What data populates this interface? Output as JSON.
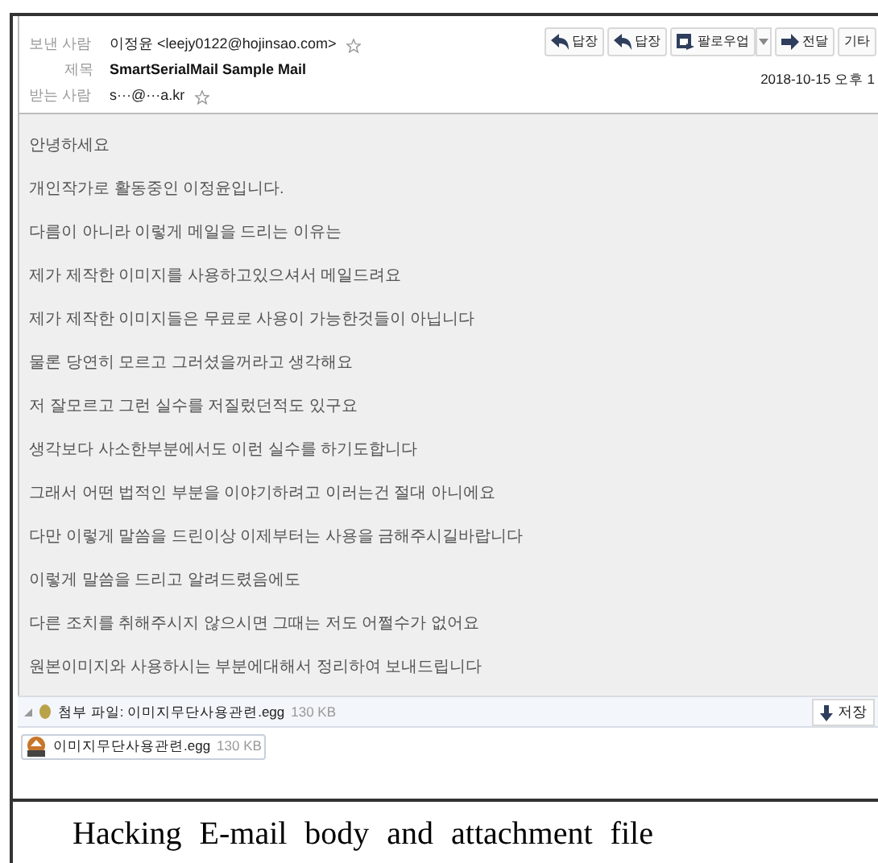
{
  "header": {
    "from_label": "보낸 사람",
    "from": "이정윤 <leejy0122@hojinsao.com>",
    "subject_label": "제목",
    "subject": "SmartSerialMail Sample Mail",
    "to_label": "받는 사람",
    "to": "s···@···a.kr",
    "date": "2018-10-15 오후 1"
  },
  "buttons": [
    {
      "label": "답장",
      "kind": "reply"
    },
    {
      "label": "답장",
      "kind": "reply-all"
    },
    {
      "label": "팔로우업",
      "kind": "followup"
    },
    {
      "label": "전달",
      "kind": "forward"
    },
    {
      "label": "기타",
      "kind": "more"
    }
  ],
  "body": [
    "안녕하세요",
    "개인작가로 활동중인 이정윤입니다.",
    "다름이 아니라 이렇게 메일을 드리는 이유는",
    "제가 제작한 이미지를 사용하고있으셔서 메일드려요",
    "제가 제작한 이미지들은 무료로 사용이 가능한것들이 아닙니다",
    "물론 당연히 모르고 그러셨을꺼라고 생각해요",
    "저 잘모르고 그런 실수를 저질렀던적도 있구요",
    "생각보다 사소한부분에서도 이런 실수를 하기도합니다",
    "그래서 어떤 법적인 부분을 이야기하려고 이러는건 절대 아니에요",
    "다만 이렇게 말씀을 드린이상 이제부터는 사용을 금해주시길바랍니다",
    "이렇게 말씀을 드리고 알려드렸음에도",
    "다른 조치를 취해주시지 않으시면 그때는 저도 어쩔수가 없어요",
    "원본이미지와 사용하시는 부분에대해서 정리하여 보내드립니다"
  ],
  "attachment_bar": {
    "label": "첨부 파일: 이미지무단사용관련.egg",
    "size": "130 KB",
    "save": "저장"
  },
  "attachment": {
    "name": "이미지무단사용관련.egg",
    "size": "130 KB"
  },
  "caption": "Hacking E-mail body and attachment file"
}
